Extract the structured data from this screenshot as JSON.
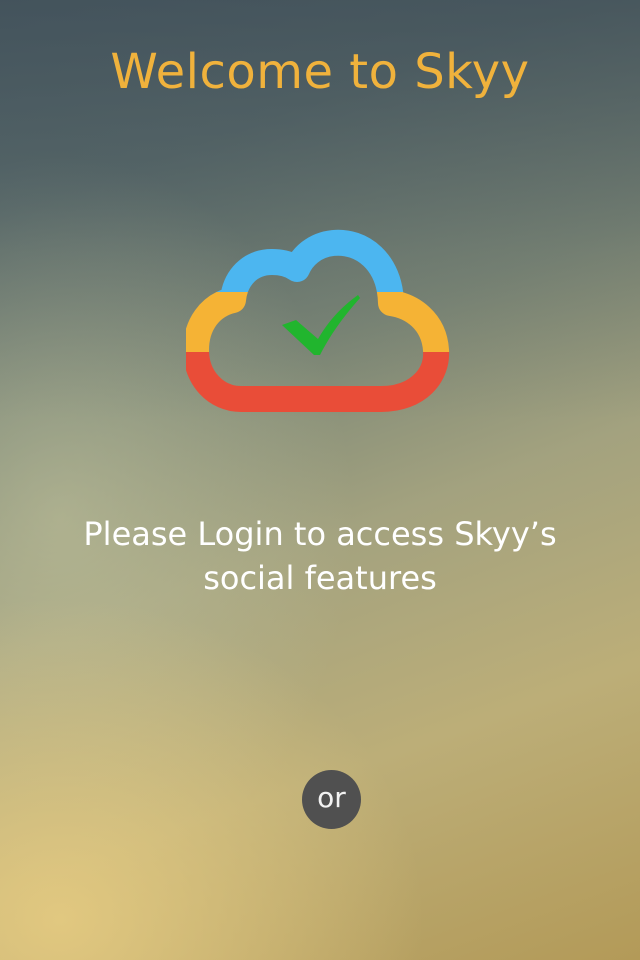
{
  "title": "Welcome to Skyy",
  "logo": {
    "icon": "cloud-check-icon",
    "colors": {
      "top": "#4cb6f0",
      "middle": "#f5b335",
      "bottom": "#e94d38",
      "check": "#21b52e"
    }
  },
  "message": "Please Login to access Skyy’s social features",
  "divider": {
    "label": "or"
  },
  "colors": {
    "title": "#f0b23c",
    "message": "#ffffff",
    "badge": "#505050"
  }
}
